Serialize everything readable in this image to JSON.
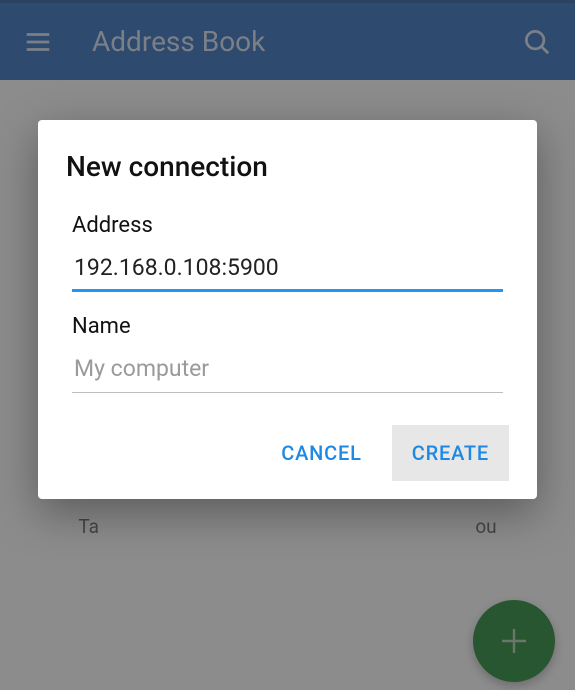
{
  "appbar": {
    "title": "Address Book"
  },
  "hint_left": "Ta",
  "hint_right": "ou",
  "dialog": {
    "title": "New connection",
    "address_label": "Address",
    "address_value": "192.168.0.108:5900",
    "name_label": "Name",
    "name_placeholder": "My computer",
    "cancel": "CANCEL",
    "create": "CREATE"
  }
}
